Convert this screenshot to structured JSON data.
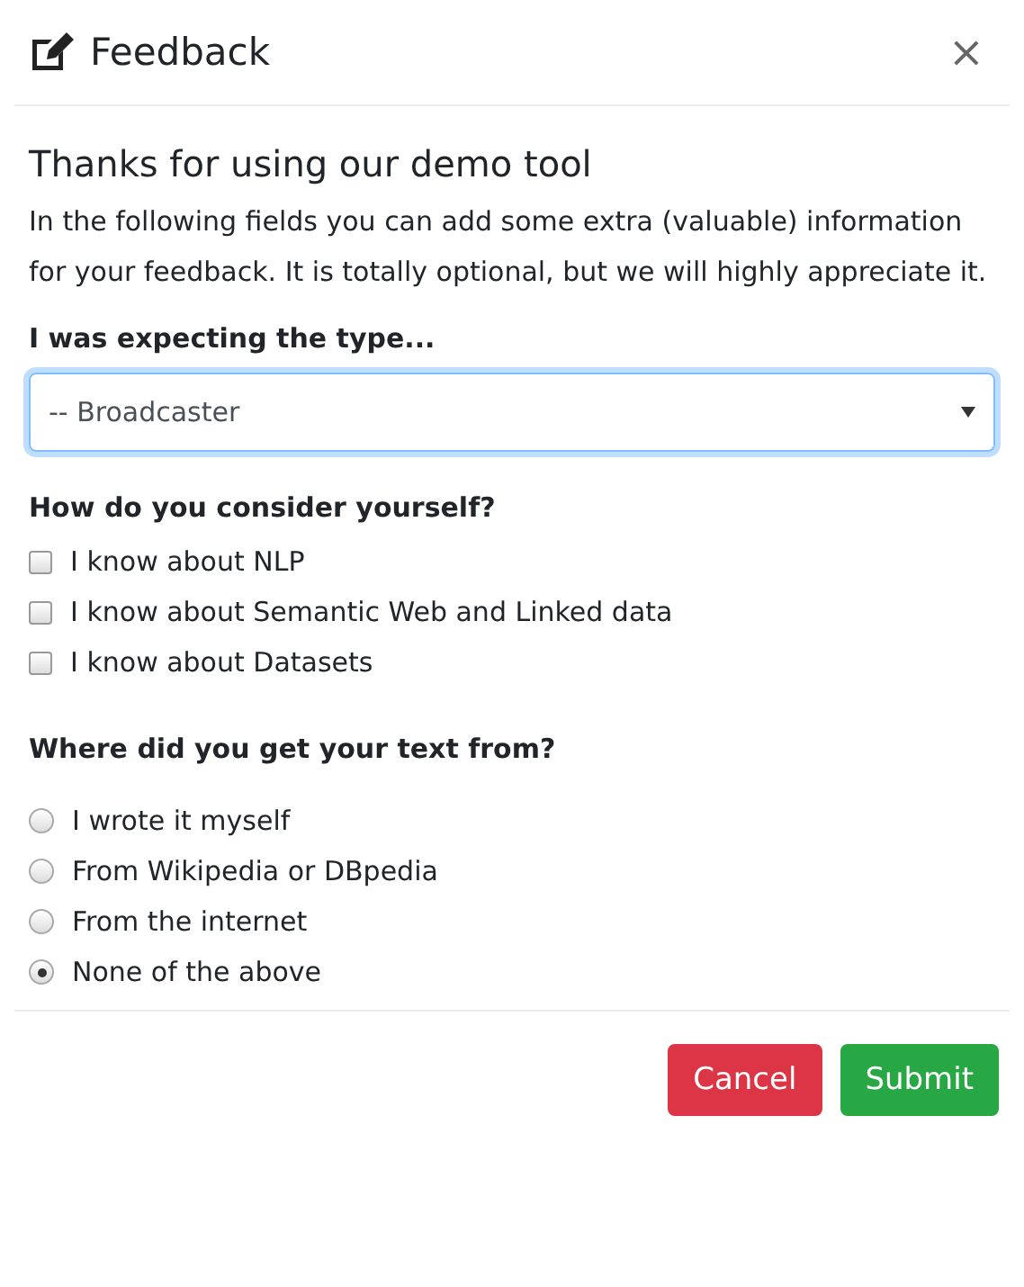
{
  "dialog": {
    "title": "Feedback",
    "close": "×"
  },
  "intro": {
    "heading": "Thanks for using our demo tool",
    "text": "In the following fields you can add some extra (valuable) information for your feedback. It is totally optional, but we will highly appreciate it."
  },
  "type_select": {
    "label": "I was expecting the type...",
    "value": "-- Broadcaster",
    "focused": true
  },
  "experience": {
    "label": "How do you consider yourself?",
    "options": [
      {
        "label": "I know about NLP",
        "checked": false
      },
      {
        "label": "I know about Semantic Web and Linked data",
        "checked": false
      },
      {
        "label": "I know about Datasets",
        "checked": false
      }
    ]
  },
  "source": {
    "label": "Where did you get your text from?",
    "options": [
      {
        "label": "I wrote it myself",
        "selected": false
      },
      {
        "label": "From Wikipedia or DBpedia",
        "selected": false
      },
      {
        "label": "From the internet",
        "selected": false
      },
      {
        "label": "None of the above",
        "selected": true
      }
    ]
  },
  "buttons": [
    {
      "label": "Cancel",
      "kind": "danger"
    },
    {
      "label": "Submit",
      "kind": "success"
    }
  ]
}
